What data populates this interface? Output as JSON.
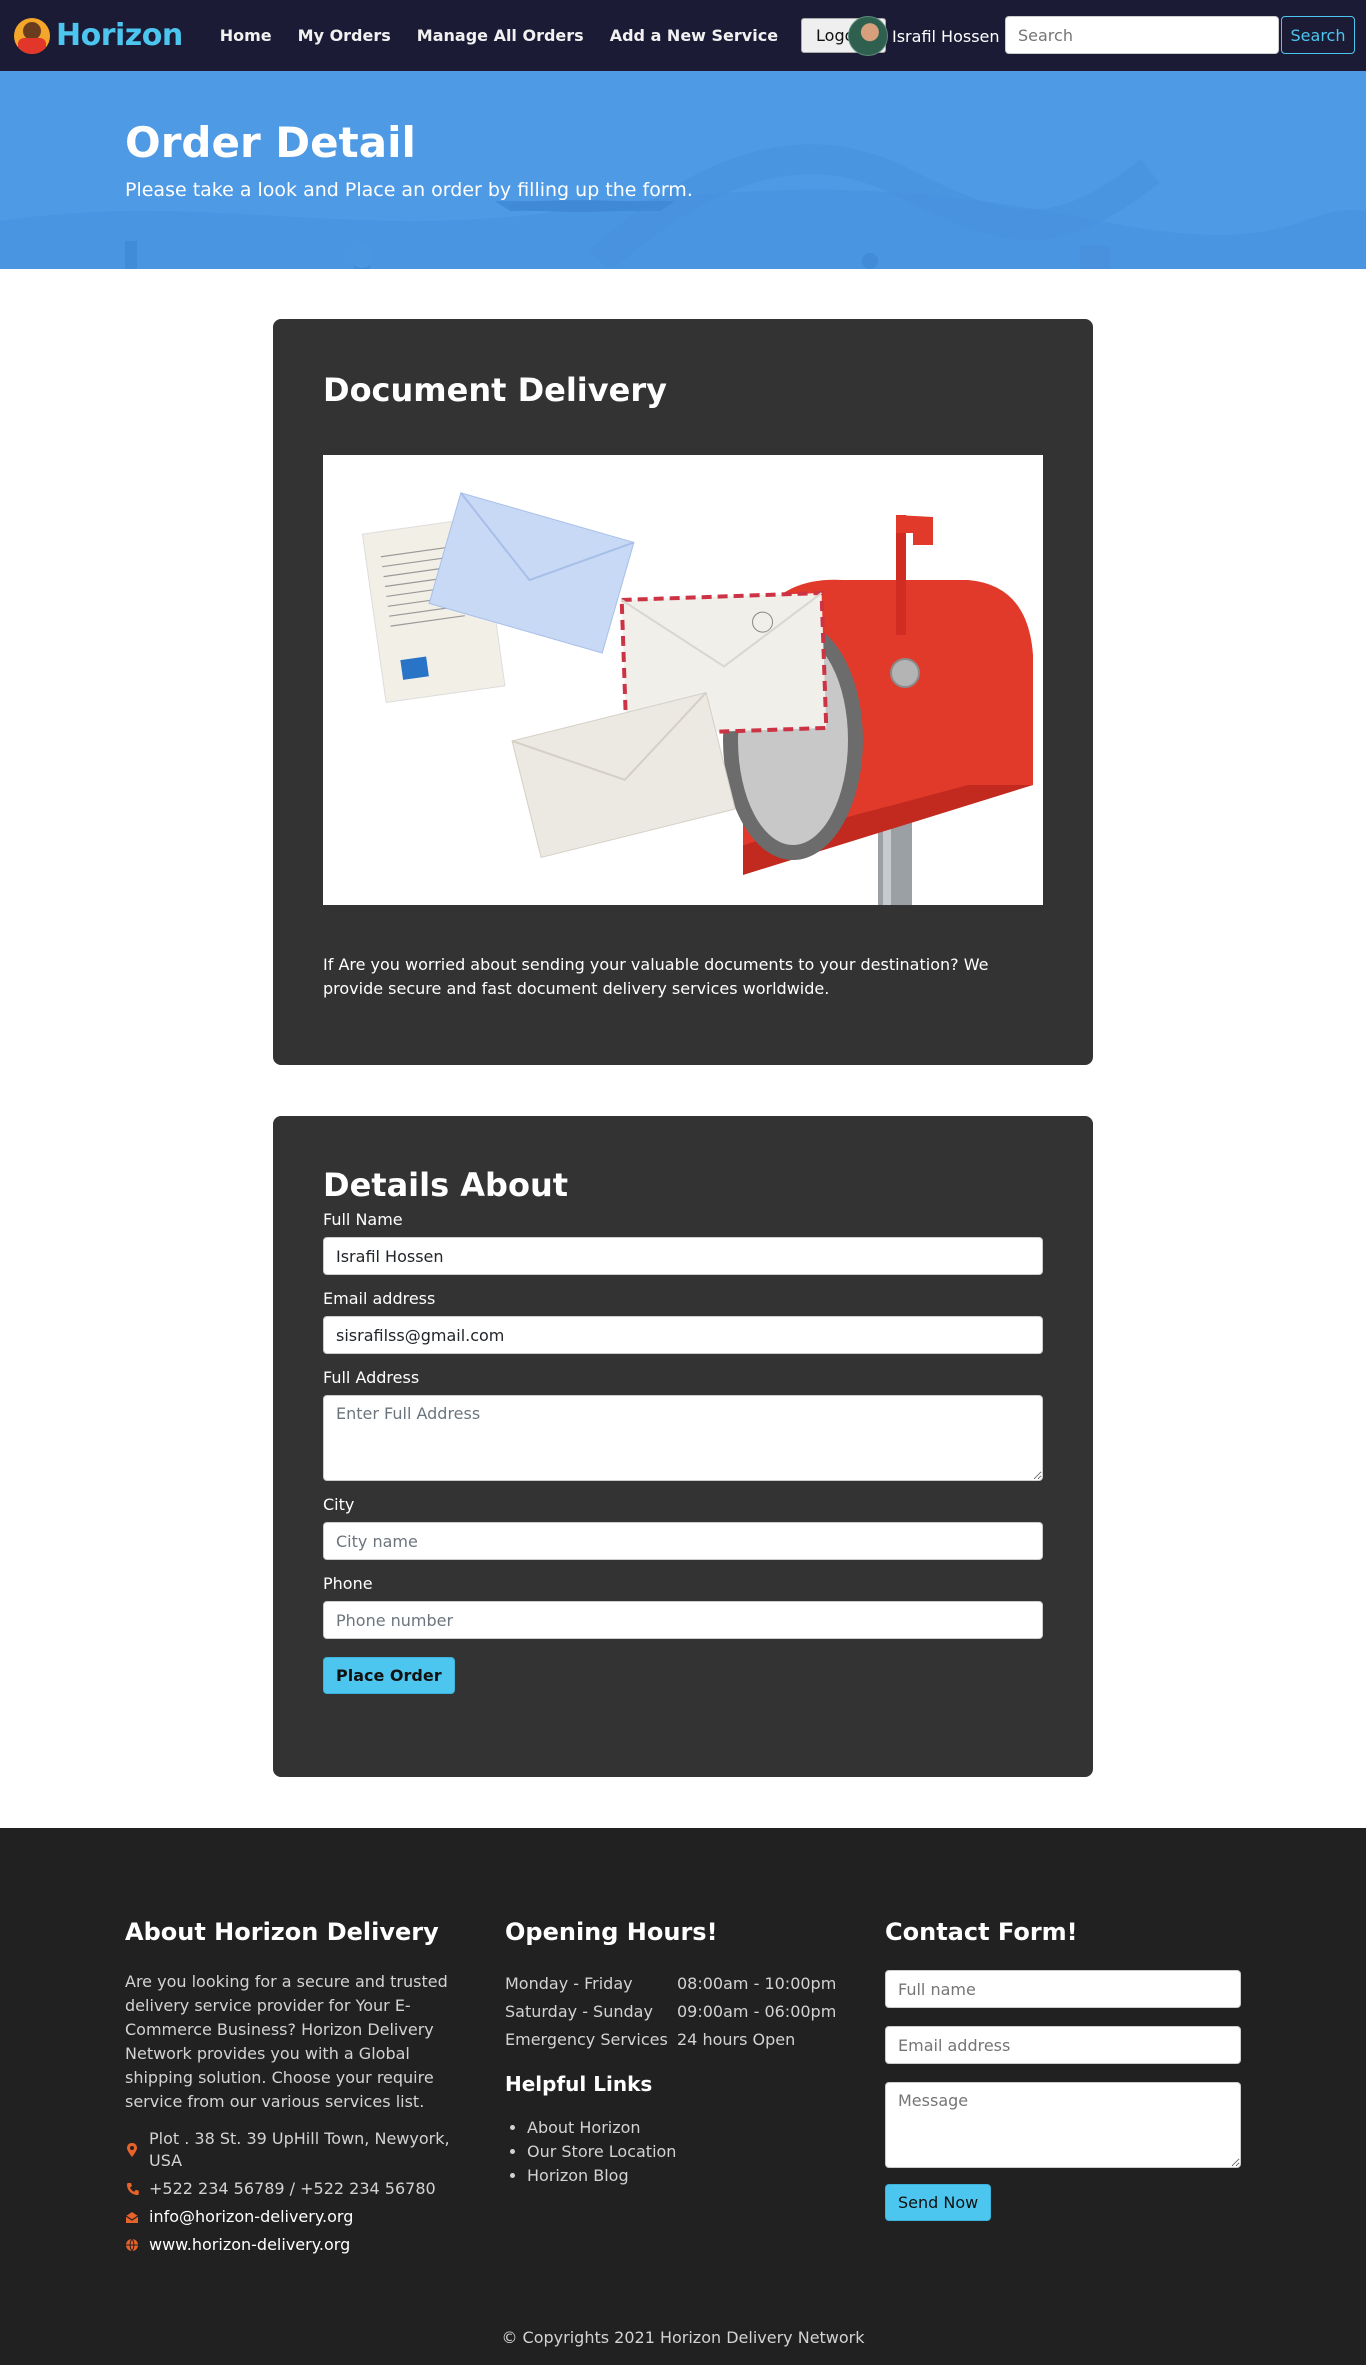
{
  "navbar": {
    "brand": "Horizon",
    "links": [
      "Home",
      "My Orders",
      "Manage All Orders",
      "Add a New Service"
    ],
    "logout_label": "Logout",
    "user_name": "Israfil Hossen",
    "search_placeholder": "Search",
    "search_button": "Search"
  },
  "hero": {
    "title": "Order Detail",
    "subtitle": "Please take a look and Place an order by filling up the form."
  },
  "service": {
    "title": "Document Delivery",
    "image_icon": "mailbox-with-envelopes-illustration",
    "description": "If Are you worried about sending your valuable documents to your destination? We provide secure and fast document delivery services worldwide."
  },
  "order_form": {
    "title": "Details About",
    "full_name_label": "Full Name",
    "full_name_value": "Israfil Hossen",
    "email_label": "Email address",
    "email_value": "sisrafilss@gmail.com",
    "address_label": "Full Address",
    "address_placeholder": "Enter Full Address",
    "city_label": "City",
    "city_placeholder": "City name",
    "phone_label": "Phone",
    "phone_placeholder": "Phone number",
    "submit_label": "Place Order"
  },
  "footer": {
    "about_title": "About Horizon Delivery",
    "about_text": "Are you looking for a secure and trusted delivery service provider for Your E-Commerce Business? Horizon Delivery Network provides you with a Global shipping solution. Choose your require service from our various services list.",
    "address": "Plot . 38 St. 39 UpHill Town, Newyork, USA",
    "phones": "+522 234 56789 / +522 234 56780",
    "email": "info@horizon-delivery.org",
    "website": "www.horizon-delivery.org",
    "hours_title": "Opening Hours!",
    "hours": [
      {
        "day": "Monday - Friday",
        "time": "08:00am - 10:00pm"
      },
      {
        "day": "Saturday - Sunday",
        "time": "09:00am - 06:00pm"
      },
      {
        "day": "Emergency Services",
        "time": "24 hours Open"
      }
    ],
    "links_title": "Helpful Links",
    "links": [
      "About Horizon",
      "Our Store Location",
      "Horizon Blog"
    ],
    "contact_title": "Contact Form!",
    "contact_name_placeholder": "Full name",
    "contact_email_placeholder": "Email address",
    "contact_message_placeholder": "Message",
    "send_label": "Send Now",
    "copyright": "© Copyrights 2021 Horizon Delivery Network"
  },
  "colors": {
    "navbar_bg": "#1c1b36",
    "brand": "#4cc6ee",
    "hero_bg": "#4f9ae5",
    "card_bg": "#333333",
    "footer_bg": "#212121",
    "accent_button": "#4cc6ee",
    "footer_icon": "#e8632b"
  }
}
